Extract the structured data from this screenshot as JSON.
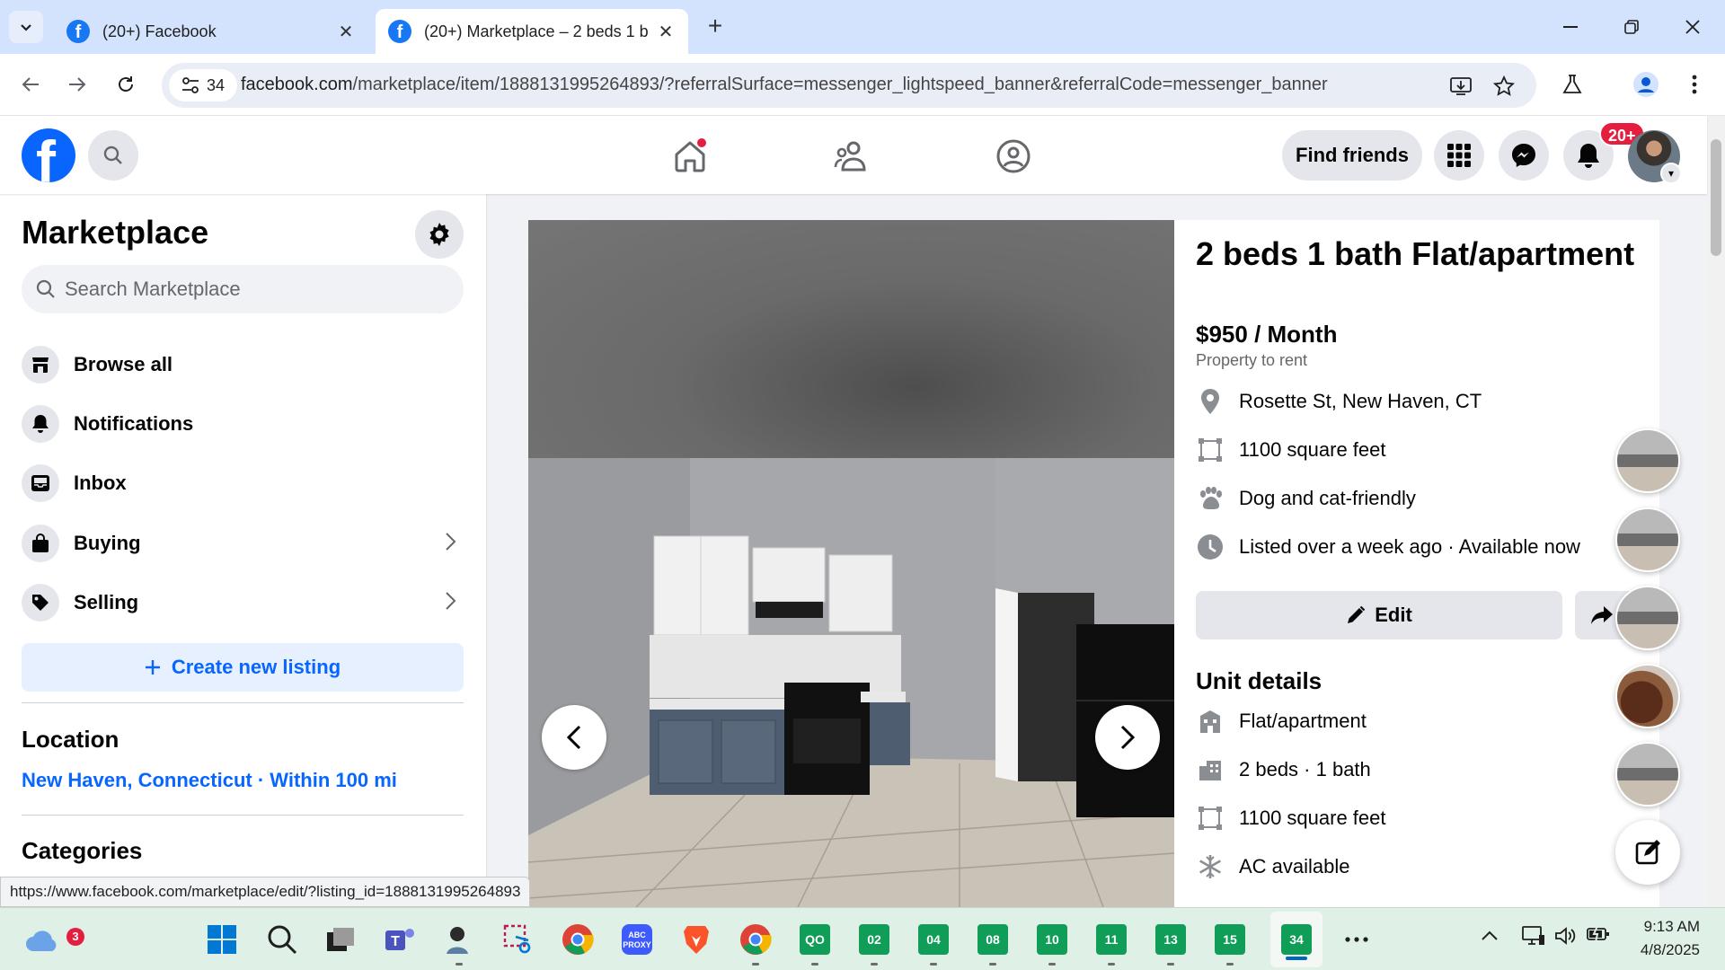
{
  "browser": {
    "tabs": [
      {
        "title": "(20+) Facebook"
      },
      {
        "title": "(20+) Marketplace – 2 beds 1 b"
      }
    ],
    "site_info_count": "34",
    "url_host": "facebook.com",
    "url_path": "/marketplace/item/1888131995264893/?referralSurface=messenger_lightspeed_banner&referralCode=messenger_banner",
    "status_url": "https://www.facebook.com/marketplace/edit/?listing_id=1888131995264893"
  },
  "header": {
    "find_friends_label": "Find friends",
    "notification_count": "20+"
  },
  "sidebar": {
    "title": "Marketplace",
    "search_placeholder": "Search Marketplace",
    "items": [
      {
        "label": "Browse all",
        "icon": "storefront-icon"
      },
      {
        "label": "Notifications",
        "icon": "bell-icon"
      },
      {
        "label": "Inbox",
        "icon": "inbox-icon"
      },
      {
        "label": "Buying",
        "icon": "shopping-bag-icon"
      },
      {
        "label": "Selling",
        "icon": "price-tag-icon"
      }
    ],
    "create_listing_label": "Create new listing",
    "location_heading": "Location",
    "location_value": "New Haven, Connecticut · Within 100 mi",
    "categories_heading": "Categories"
  },
  "listing": {
    "title": "2 beds 1 bath Flat/apartment",
    "price": "$950 / Month",
    "subtitle": "Property to rent",
    "info": [
      {
        "icon": "location-pin-icon",
        "text": "Rosette St, New Haven, CT"
      },
      {
        "icon": "area-icon",
        "text": "1100 square feet"
      },
      {
        "icon": "paw-icon",
        "text": "Dog and cat-friendly"
      },
      {
        "icon": "clock-icon",
        "text": "Listed over a week ago · Available now"
      }
    ],
    "edit_label": "Edit",
    "unit_details_heading": "Unit details",
    "unit_details": [
      {
        "icon": "building-icon",
        "text": "Flat/apartment"
      },
      {
        "icon": "bed-icon",
        "text": "2 beds · 1 bath"
      },
      {
        "icon": "area-icon",
        "text": "1100 square feet"
      },
      {
        "icon": "snowflake-icon",
        "text": "AC available"
      }
    ]
  },
  "taskbar": {
    "weather_badge": "3",
    "numbered_apps": [
      "02",
      "04",
      "08",
      "10",
      "11",
      "13",
      "15",
      "34"
    ],
    "abc_label": "ABC PROXY",
    "time": "9:13 AM",
    "date": "4/8/2025"
  },
  "colors": {
    "facebook_blue": "#0866ff",
    "notification_red": "#e41e3f",
    "taskbar_app_green": "#0f9d58"
  }
}
